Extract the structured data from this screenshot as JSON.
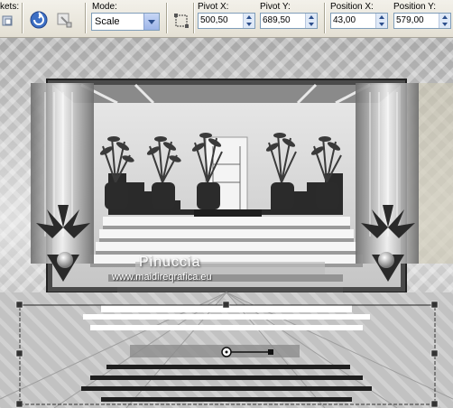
{
  "toolbar": {
    "presets_label": "kets:",
    "mode_label": "Mode:",
    "mode_value": "Scale",
    "pivot_x_label": "Pivot X:",
    "pivot_x_value": "500,50",
    "pivot_y_label": "Pivot Y:",
    "pivot_y_value": "689,50",
    "position_x_label": "Position X:",
    "position_x_value": "43,00",
    "position_y_label": "Position Y:",
    "position_y_value": "579,00"
  },
  "canvas": {
    "watermark_name": "Pinuccia",
    "watermark_url": "www.maidireqrafica.eu"
  },
  "icons": {
    "apply": "apply-icon",
    "reset": "reset-icon",
    "transform": "transform-icon",
    "bbox": "bounding-box-icon"
  }
}
